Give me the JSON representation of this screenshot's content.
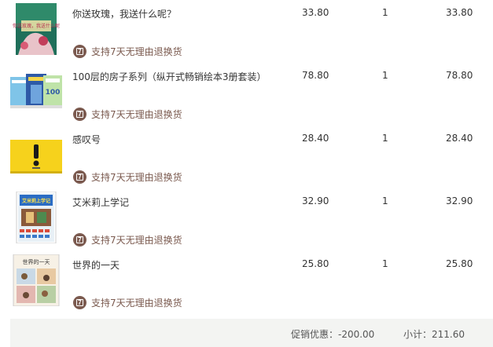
{
  "items": [
    {
      "title": "你送玫瑰，我送什么呢？",
      "price": "33.80",
      "qty": "1",
      "subtotal": "33.80",
      "service_badge": "7",
      "service_text": "支持7天无理由退换货",
      "cover_title": "你送玫瑰，我送什么呢",
      "thumb_icon": "book-cover-rose-icon"
    },
    {
      "title": "100层的房子系列（纵开式畅销绘本3册套装）",
      "price": "78.80",
      "qty": "1",
      "subtotal": "78.80",
      "service_badge": "7",
      "service_text": "支持7天无理由退换货",
      "thumb_icon": "book-set-house-icon"
    },
    {
      "title": "感叹号",
      "price": "28.40",
      "qty": "1",
      "subtotal": "28.40",
      "service_badge": "7",
      "service_text": "支持7天无理由退换货",
      "thumb_icon": "book-cover-exclamation-icon"
    },
    {
      "title": "艾米莉上学记",
      "price": "32.90",
      "qty": "1",
      "subtotal": "32.90",
      "service_badge": "7",
      "service_text": "支持7天无理由退换货",
      "cover_title": "艾米莉上学记",
      "thumb_icon": "book-cover-school-icon"
    },
    {
      "title": "世界的一天",
      "price": "25.80",
      "qty": "1",
      "subtotal": "25.80",
      "service_badge": "7",
      "service_text": "支持7天无理由退换货",
      "cover_title": "世界的一天",
      "thumb_icon": "book-cover-world-icon"
    }
  ],
  "footer": {
    "discount_label": "促销优惠：-200.00",
    "total_label": "小计：211.60"
  },
  "colors": {
    "service_brown": "#7b5a4f",
    "footer_bg": "#f3f4f2",
    "text": "#333333"
  }
}
